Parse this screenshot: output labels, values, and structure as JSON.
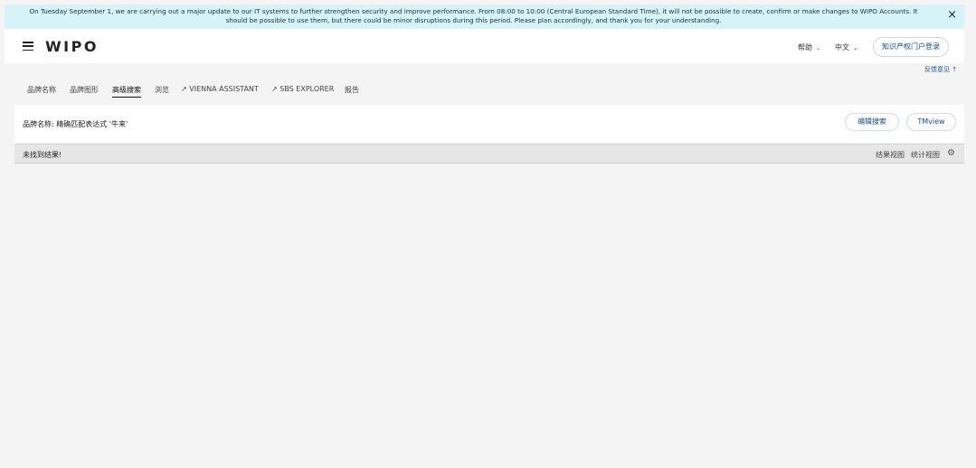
{
  "banner": {
    "text": "On Tuesday September 1, we are carrying out a major update to our IT systems to further strengthen security and improve performance. From 08:00 to 10:00 (Central European Standard Time), it will not be possible to create, confirm or make changes to WIPO Accounts. It should be possible to use them, but there could be minor disruptions during this period. Please plan accordingly, and thank you for your understanding.",
    "close_icon": "×"
  },
  "header": {
    "logo": "WIPO",
    "lang_code": "帮助",
    "lang_select": "中文",
    "login_label": "知识产权门户登录"
  },
  "feedback": {
    "label": "反馈意见",
    "arrow": "↑"
  },
  "tabs": [
    {
      "label": "品牌名称"
    },
    {
      "label": "品牌图形"
    },
    {
      "label": "高级搜索"
    },
    {
      "label": "浏览"
    },
    {
      "label": "↗ VIENNA ASSISTANT"
    },
    {
      "label": "↗ SBS EXPLORER"
    },
    {
      "label": "报告"
    }
  ],
  "query": {
    "text": "品牌名称: 精确匹配表达式 '牛来'",
    "edit_label": "编辑搜索",
    "tmview_label": "TMview"
  },
  "results": {
    "message": "未找到结果!",
    "result_view": "结果视图",
    "stats_view": "统计视图",
    "gear_icon": "⚙"
  }
}
